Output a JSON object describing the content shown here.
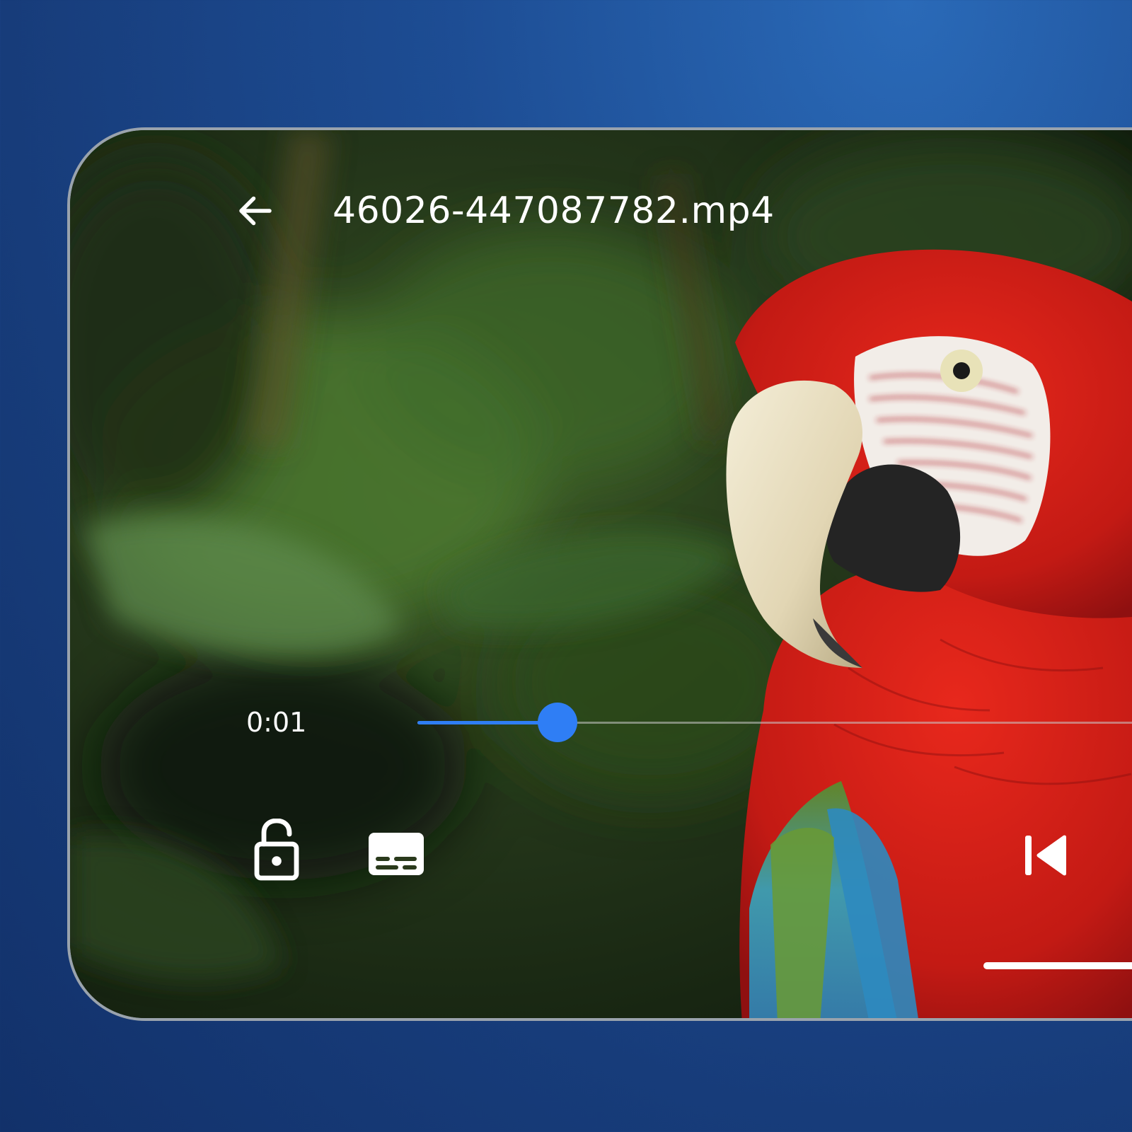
{
  "player": {
    "file_name": "46026-447087782.mp4",
    "elapsed_time": "0:01",
    "progress_percent": 18,
    "accent_color": "#2f7ef5"
  },
  "icons": {
    "back": "arrow-left-icon",
    "lock": "lock-open-icon",
    "subtitles": "subtitles-icon",
    "previous": "skip-previous-icon"
  }
}
